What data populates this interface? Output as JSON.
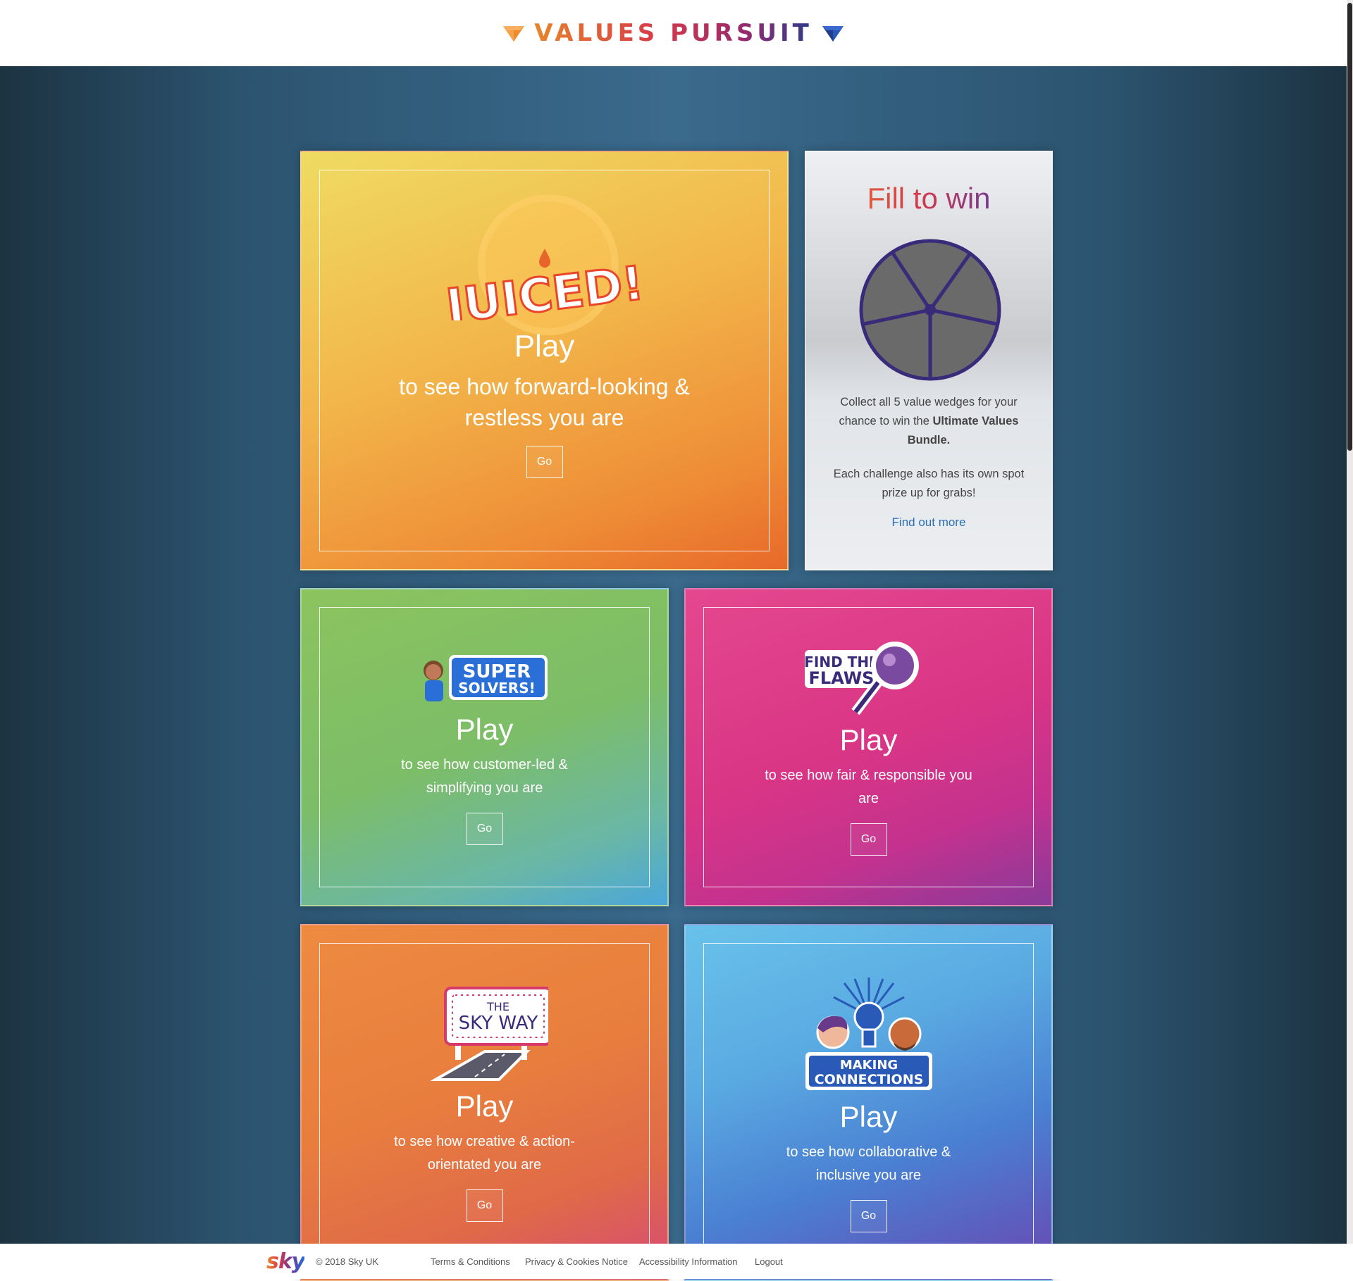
{
  "header": {
    "title": "VALUES PURSUIT"
  },
  "colors": {
    "accent_orange": "#e8842a",
    "accent_red": "#d63a4a",
    "accent_blue": "#2a3c8c",
    "link_blue": "#2a6fb8"
  },
  "cards": {
    "juiced": {
      "logo_text": "JUICED!",
      "play": "Play",
      "desc": "to see how forward-looking & restless you are",
      "go": "Go"
    },
    "super_solvers": {
      "logo_line1": "SUPER",
      "logo_line2": "SOLVERS!",
      "play": "Play",
      "desc": "to see how customer-led & simplifying you are",
      "go": "Go"
    },
    "find_the_flaws": {
      "logo_line1": "FIND THE",
      "logo_line2": "FLAWS",
      "play": "Play",
      "desc": "to see how fair & responsible you are",
      "go": "Go"
    },
    "sky_way": {
      "logo_line1": "THE",
      "logo_line2": "SKY WAY",
      "play": "Play",
      "desc": "to see how creative & action-orientated you are",
      "go": "Go"
    },
    "making_connections": {
      "logo_line1": "MAKING",
      "logo_line2": "CONNECTIONS",
      "play": "Play",
      "desc": "to see how collaborative & inclusive you are",
      "go": "Go"
    }
  },
  "fill_to_win": {
    "title": "Fill to win",
    "desc1_prefix": "Collect all 5 value wedges for your chance to win the ",
    "desc1_bold": "Ultimate Values Bundle.",
    "desc2": "Each challenge also has its own spot prize up for grabs!",
    "link": "Find out more",
    "wedges_filled": 0,
    "wedges_total": 5
  },
  "footer": {
    "logo": "sky",
    "copyright": "© 2018 Sky UK",
    "links": [
      "Terms & Conditions",
      "Privacy & Cookies Notice",
      "Accessibility Information",
      "Logout"
    ]
  }
}
